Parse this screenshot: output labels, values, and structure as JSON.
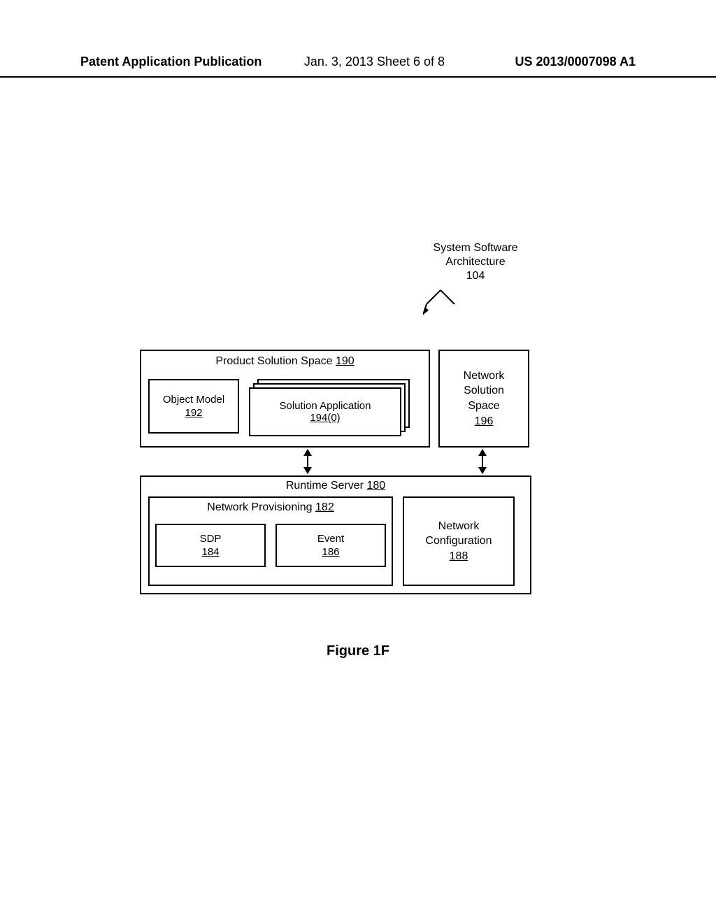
{
  "header": {
    "left": "Patent Application Publication",
    "center": "Jan. 3, 2013  Sheet 6 of 8",
    "right": "US 2013/0007098 A1"
  },
  "sys_label": {
    "l1": "System Software",
    "l2": "Architecture",
    "l3": "104"
  },
  "pss": {
    "title_text": "Product Solution Space",
    "title_num": "190",
    "obj_model": {
      "l1": "Object Model",
      "num": "192"
    },
    "sol_app": {
      "l1": "Solution Application",
      "num": "194(0)"
    }
  },
  "nss": {
    "l1": "Network",
    "l2": "Solution",
    "l3": "Space",
    "num": "196"
  },
  "runtime": {
    "title_text": "Runtime Server",
    "title_num": "180",
    "np": {
      "title_text": "Network Provisioning",
      "title_num": "182",
      "sdp": {
        "l1": "SDP",
        "num": "184"
      },
      "event": {
        "l1": "Event",
        "num": "186"
      }
    },
    "net_conf": {
      "l1": "Network",
      "l2": "Configuration",
      "num": "188"
    }
  },
  "figure_caption": "Figure 1F"
}
